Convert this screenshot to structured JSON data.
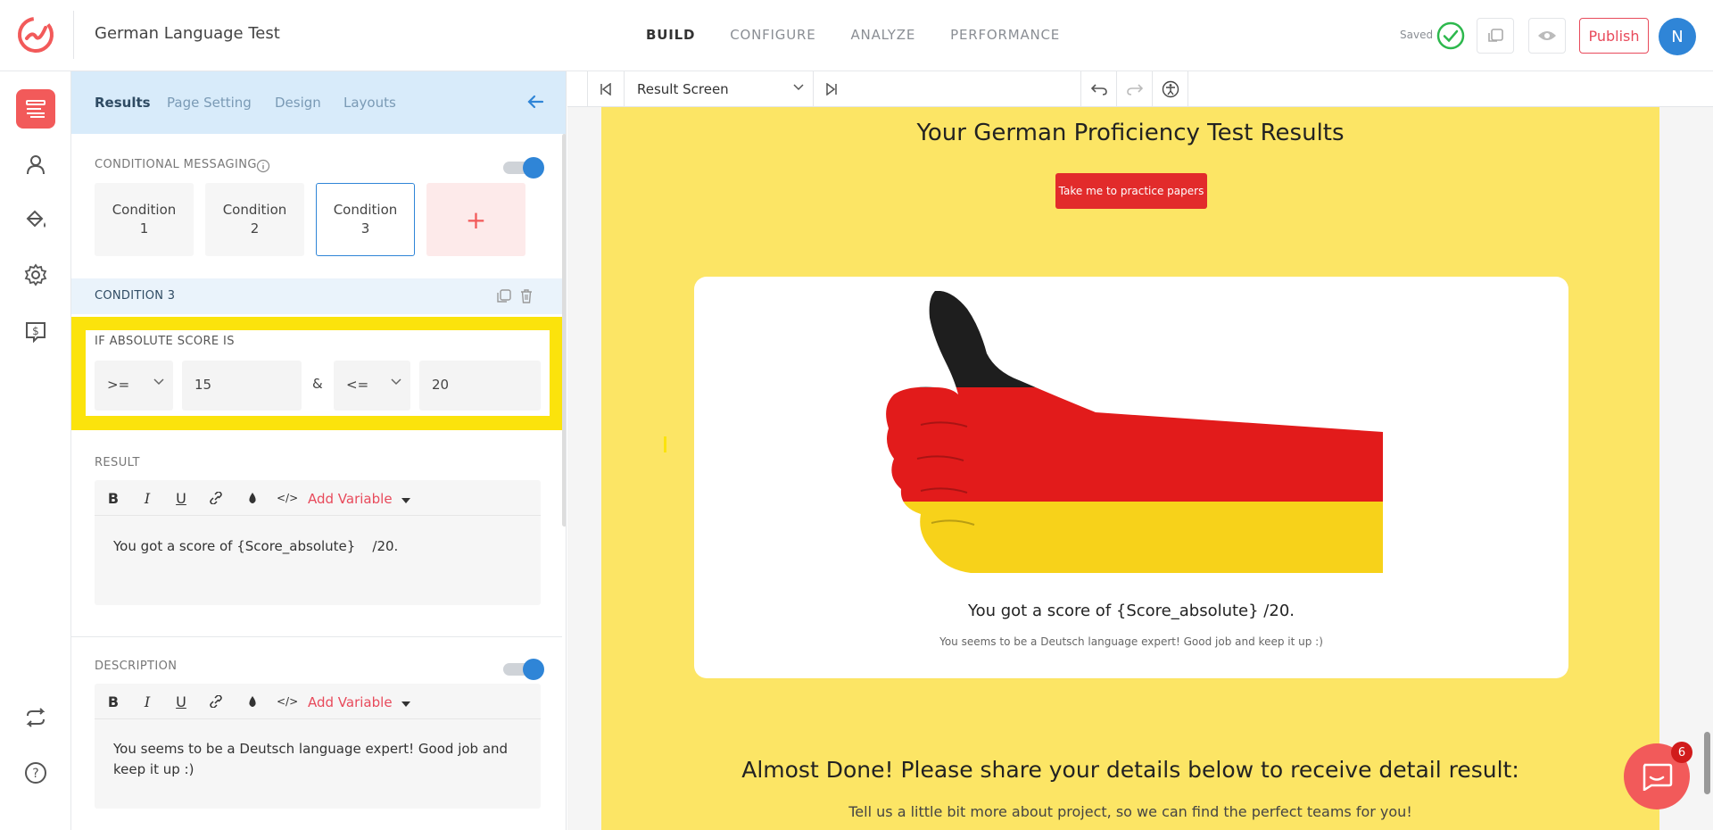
{
  "app": {
    "title": "German Language Test"
  },
  "main_tabs": [
    {
      "label": "BUILD",
      "active": true
    },
    {
      "label": "CONFIGURE",
      "active": false
    },
    {
      "label": "ANALYZE",
      "active": false
    },
    {
      "label": "PERFORMANCE",
      "active": false
    }
  ],
  "header": {
    "saved_label": "Saved",
    "publish_label": "Publish",
    "avatar_initial": "N"
  },
  "colors": {
    "accent": "#f25a5a",
    "brand_blue": "#2f85d7",
    "canvas_yellow": "#fce565",
    "highlight": "#fbe30c"
  },
  "rail_icons": [
    "layout-icon",
    "user-icon",
    "paint-bucket-icon",
    "gear-icon",
    "pricing-icon",
    "sync-icon",
    "help-icon"
  ],
  "panel": {
    "tabs": [
      {
        "label": "Results",
        "active": true
      },
      {
        "label": "Page Setting",
        "active": false
      },
      {
        "label": "Design",
        "active": false
      },
      {
        "label": "Layouts",
        "active": false
      }
    ],
    "conditional_messaging_label": "CONDITIONAL MESSAGING",
    "conditions": [
      {
        "line1": "Condition",
        "line2": "1"
      },
      {
        "line1": "Condition",
        "line2": "2"
      },
      {
        "line1": "Condition",
        "line2": "3"
      }
    ],
    "add_condition": "+",
    "condition_header": "CONDITION 3",
    "score_label": "IF ABSOLUTE SCORE IS",
    "op1": ">=",
    "val1": "15",
    "amp": "&",
    "op2": "<=",
    "val2": "20",
    "result_label": "RESULT",
    "add_variable": "Add Variable",
    "result_text": "You got a score of {Score_absolute}    /20.",
    "description_label": "DESCRIPTION",
    "description_text": "You seems to be a Deutsch language expert! Good job and keep it up :)"
  },
  "preview": {
    "screen_select": "Result Screen",
    "title": "Your German Proficiency Test Results",
    "practice_button": "Take me to practice papers",
    "score_text": "You got a score of {Score_absolute} /20.",
    "desc_text": "You seems to be a Deutsch language expert! Good job and keep it up :)",
    "almost_title": "Almost Done! Please share your details below to receive detail result:",
    "tell_text": "Tell us a little bit more about project, so we can find the perfect teams for you!"
  },
  "chat": {
    "badge_count": "6"
  }
}
